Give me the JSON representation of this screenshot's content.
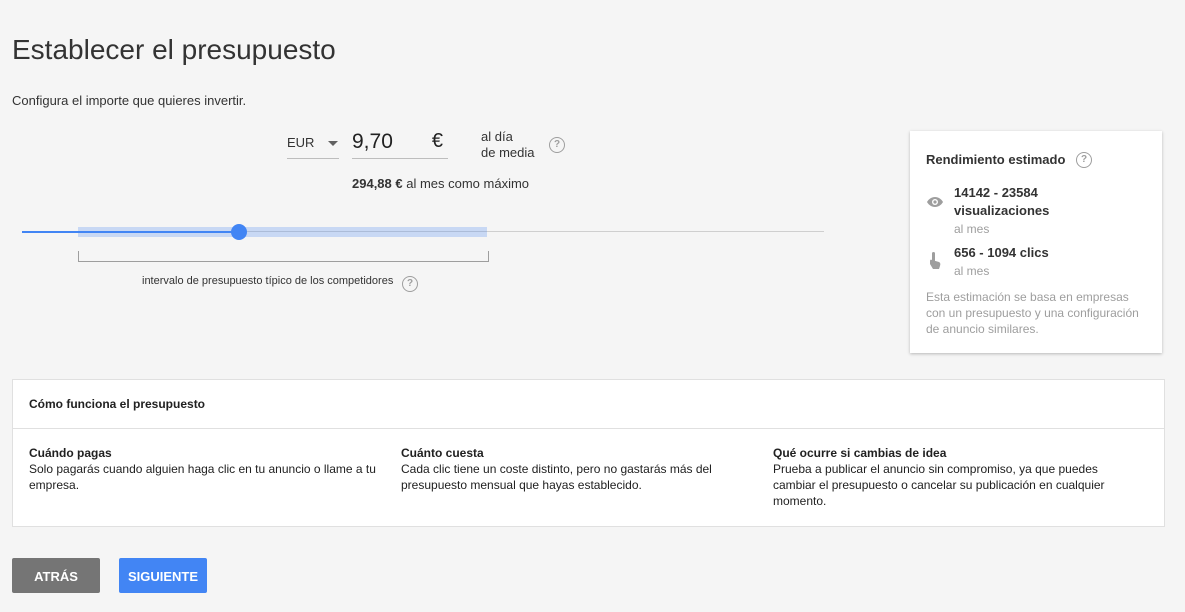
{
  "page": {
    "title": "Establecer el presupuesto",
    "subtitle": "Configura el importe que quieres invertir."
  },
  "budget": {
    "currency": "EUR",
    "amount": "9,70",
    "currency_symbol": "€",
    "per_day_line1": "al día",
    "per_day_line2": "de media",
    "monthly_max_amount": "294,88 €",
    "monthly_max_text": " al mes como máximo",
    "range_label": "intervalo de presupuesto típico de los competidores"
  },
  "slider": {
    "value_fraction": 0.27,
    "competitor_range_fraction": [
      0.07,
      0.58
    ]
  },
  "performance": {
    "title": "Rendimiento estimado",
    "views_value": "14142 - 23584",
    "views_label": "visualizaciones",
    "views_period": "al mes",
    "clicks_value": "656 - 1094  clics",
    "clicks_period": "al mes",
    "note": "Esta estimación se basa en empresas con un presupuesto y una configuración de anuncio similares."
  },
  "how_it_works": {
    "title": "Cómo funciona el presupuesto",
    "columns": [
      {
        "heading": "Cuándo pagas",
        "text": "Solo pagarás cuando alguien haga clic en tu anuncio o llame a tu empresa."
      },
      {
        "heading": "Cuánto cuesta",
        "text": "Cada clic tiene un coste distinto, pero no gastarás más del presupuesto mensual que hayas establecido."
      },
      {
        "heading": "Qué ocurre si cambias de idea",
        "text": "Prueba a publicar el anuncio sin compromiso, ya que puedes cambiar el presupuesto o cancelar su publicación en cualquier momento."
      }
    ]
  },
  "buttons": {
    "back": "ATRÁS",
    "next": "SIGUIENTE"
  },
  "icons": {
    "help": "help-icon",
    "views": "eye-icon",
    "clicks": "touch-icon"
  },
  "colors": {
    "accent": "#4285f4",
    "back_button": "#757575"
  }
}
